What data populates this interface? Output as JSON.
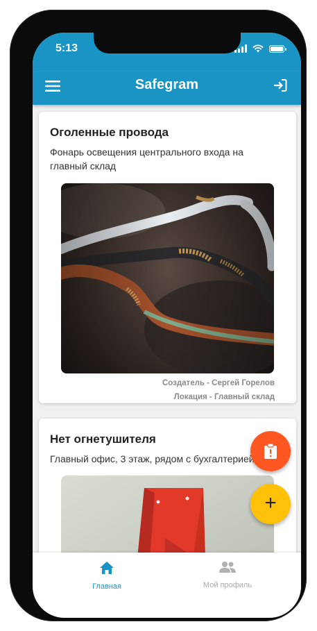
{
  "status_bar": {
    "time": "5:13"
  },
  "app_bar": {
    "title": "Safegram",
    "menu_icon": "menu-icon",
    "logout_icon": "logout-icon"
  },
  "posts": [
    {
      "title": "Оголенные провода",
      "description": "Фонарь освещения центрального входа на главный склад",
      "creator": "Создатель - Сергей Горелов",
      "location": "Локация - Главный склад"
    },
    {
      "title": "Нет огнетушителя",
      "description": "Главный офис, 3 этаж, рядом с бухгалтерией"
    }
  ],
  "fabs": {
    "report_icon": "clipboard-alert-icon",
    "add_label": "+"
  },
  "bottom_nav": {
    "items": [
      {
        "label": "Главная",
        "icon": "home-icon",
        "active": true
      },
      {
        "label": "Мой профиль",
        "icon": "people-icon",
        "active": false
      }
    ]
  },
  "colors": {
    "primary": "#1a94c5",
    "report_fab": "#ff5722",
    "add_fab": "#ffc107",
    "inactive": "#aaaaaa"
  }
}
